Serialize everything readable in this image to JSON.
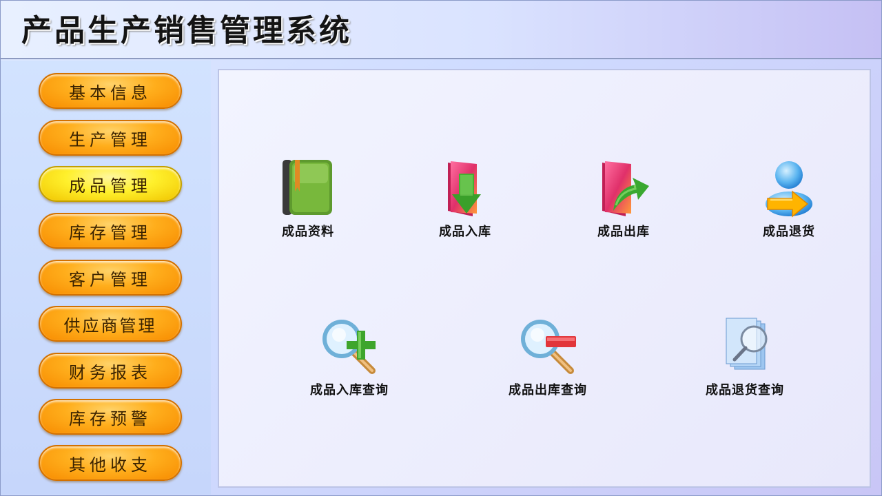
{
  "app": {
    "title": "产品生产销售管理系统"
  },
  "sidebar": {
    "items": [
      {
        "label": "基本信息"
      },
      {
        "label": "生产管理"
      },
      {
        "label": "成品管理",
        "active": true
      },
      {
        "label": "库存管理"
      },
      {
        "label": "客户管理"
      },
      {
        "label": "供应商管理"
      },
      {
        "label": "财务报表"
      },
      {
        "label": "库存预警"
      },
      {
        "label": "其他收支"
      }
    ]
  },
  "main": {
    "functions": [
      {
        "label": "成品资料",
        "icon": "green-book-icon"
      },
      {
        "label": "成品入库",
        "icon": "folder-arrow-down-icon"
      },
      {
        "label": "成品出库",
        "icon": "folder-arrow-out-icon"
      },
      {
        "label": "成品退货",
        "icon": "user-return-icon"
      },
      {
        "label": "成品入库查询",
        "icon": "magnifier-plus-icon"
      },
      {
        "label": "成品出库查询",
        "icon": "magnifier-minus-icon"
      },
      {
        "label": "成品退货查询",
        "icon": "document-search-icon"
      }
    ]
  },
  "colors": {
    "nav_button": "#ffae1c",
    "nav_button_active": "#fff02c",
    "panel_background": "#eeeffc"
  }
}
